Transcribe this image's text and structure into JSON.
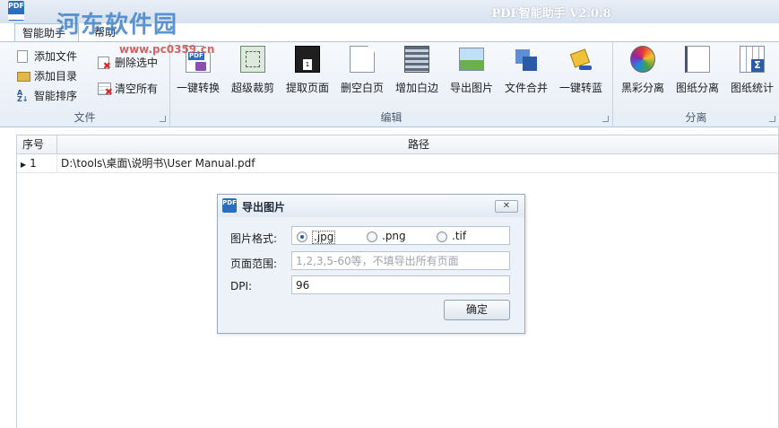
{
  "window": {
    "title": "PDF智能助手 V2.0.8",
    "app_icon_text": "PDF"
  },
  "watermark": {
    "text": "河东软件园",
    "url": "www.pc0359.cn"
  },
  "tabs": [
    {
      "label": "智能助手"
    },
    {
      "label": "帮助"
    }
  ],
  "ribbon": {
    "file_group": {
      "label": "文件",
      "buttons": [
        {
          "label": "添加文件"
        },
        {
          "label": "添加目录"
        },
        {
          "label": "智能排序"
        },
        {
          "label": "删除选中"
        },
        {
          "label": "清空所有"
        }
      ]
    },
    "edit_group": {
      "label": "编辑",
      "buttons": [
        {
          "label": "一键转换"
        },
        {
          "label": "超级裁剪"
        },
        {
          "label": "提取页面"
        },
        {
          "label": "删空白页"
        },
        {
          "label": "增加白边"
        },
        {
          "label": "导出图片"
        },
        {
          "label": "文件合并"
        },
        {
          "label": "一键转蓝"
        }
      ]
    },
    "split_group": {
      "label": "分离",
      "buttons": [
        {
          "label": "黑彩分离"
        },
        {
          "label": "图纸分离"
        },
        {
          "label": "图纸统计"
        }
      ]
    }
  },
  "table": {
    "columns": [
      "序号",
      "路径"
    ],
    "rows": [
      {
        "index": "1",
        "path": "D:\\tools\\桌面\\说明书\\User Manual.pdf"
      }
    ]
  },
  "dialog": {
    "title": "导出图片",
    "icon_text": "PDF",
    "close_label": "✕",
    "format_label": "图片格式:",
    "formats": [
      {
        "label": ".jpg",
        "checked": true
      },
      {
        "label": ".png",
        "checked": false
      },
      {
        "label": ".tif",
        "checked": false
      }
    ],
    "range_label": "页面范围:",
    "range_placeholder": "1,2,3,5-60等，不填导出所有页面",
    "range_value": "",
    "dpi_label": "DPI:",
    "dpi_value": "96",
    "ok_label": "确定"
  },
  "colors": {
    "accent": "#2a6ebf",
    "ribbon_border": "#b3c3d8",
    "delete_red": "#d42b2b"
  }
}
